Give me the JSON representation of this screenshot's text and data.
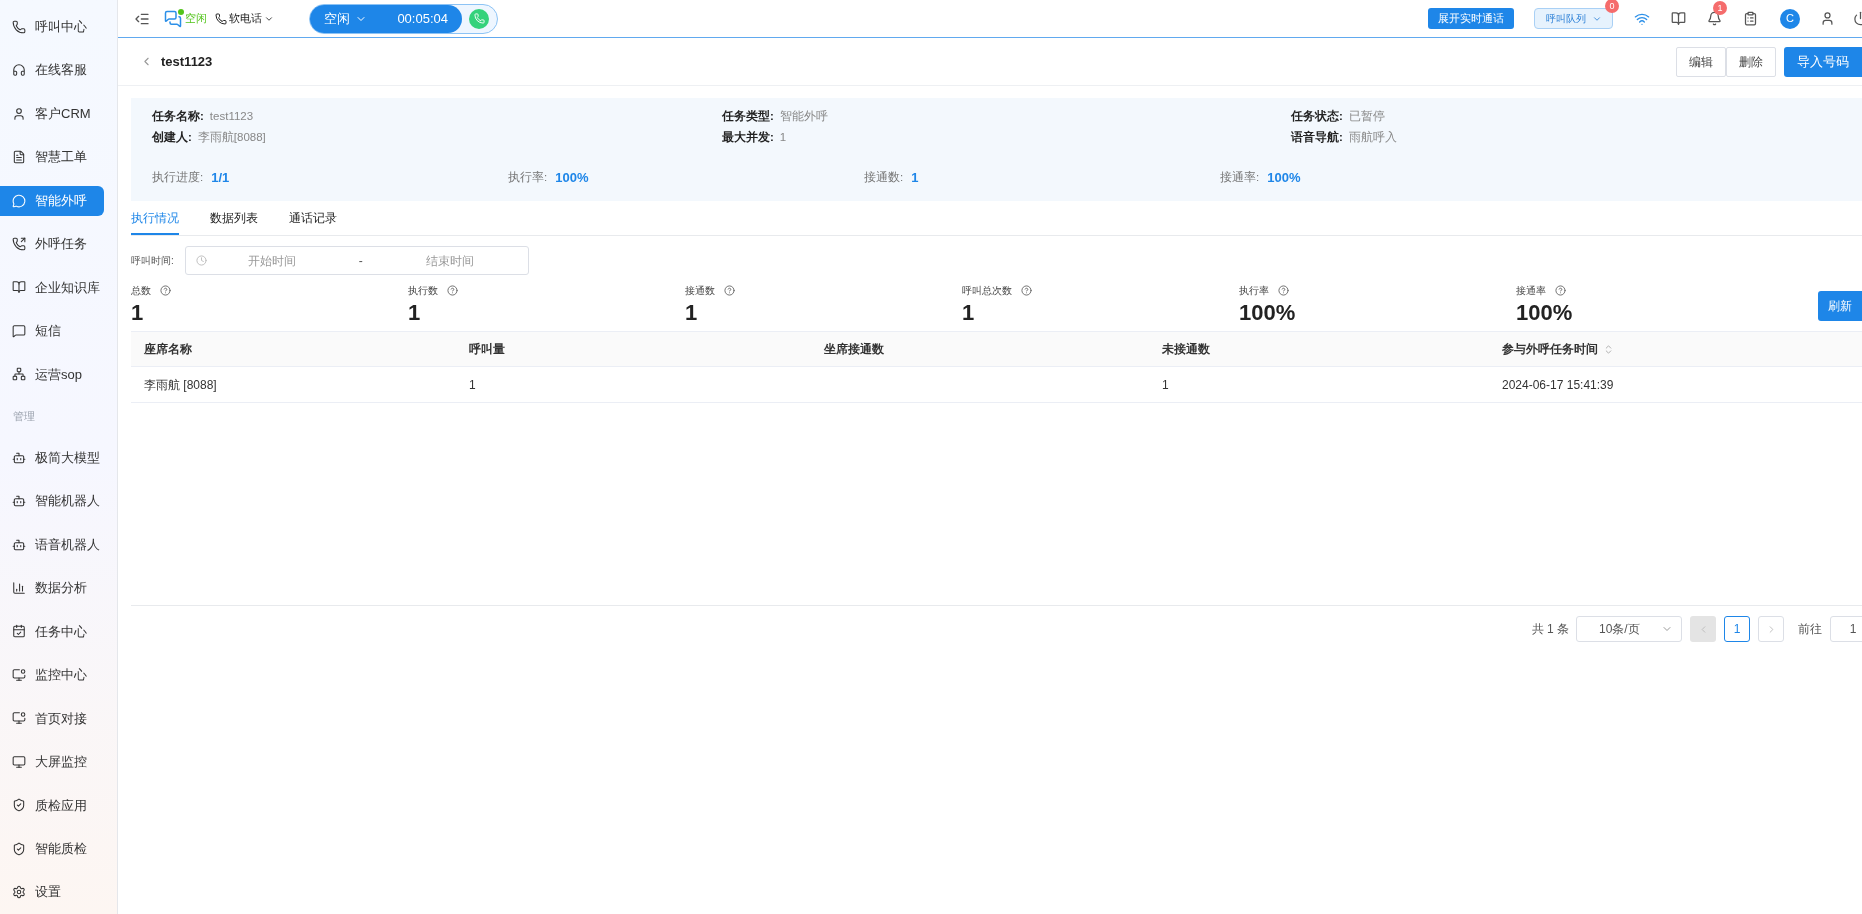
{
  "sidebar": {
    "items": [
      {
        "kind": "item",
        "label": "呼叫中心",
        "selected": false
      },
      {
        "kind": "item",
        "label": "在线客服",
        "selected": false
      },
      {
        "kind": "item",
        "label": "客户CRM",
        "selected": false
      },
      {
        "kind": "item",
        "label": "智慧工单",
        "selected": false
      },
      {
        "kind": "item",
        "label": "智能外呼",
        "selected": true
      },
      {
        "kind": "item",
        "label": "外呼任务",
        "selected": false
      },
      {
        "kind": "item",
        "label": "企业知识库",
        "selected": false
      },
      {
        "kind": "item",
        "label": "短信",
        "selected": false
      },
      {
        "kind": "item",
        "label": "运营sop",
        "selected": false
      },
      {
        "kind": "section",
        "label": "管理"
      },
      {
        "kind": "item",
        "label": "极简大模型",
        "selected": false
      },
      {
        "kind": "item",
        "label": "智能机器人",
        "selected": false
      },
      {
        "kind": "item",
        "label": "语音机器人",
        "selected": false
      },
      {
        "kind": "item",
        "label": "数据分析",
        "selected": false
      },
      {
        "kind": "item",
        "label": "任务中心",
        "selected": false
      },
      {
        "kind": "item",
        "label": "监控中心",
        "selected": false
      },
      {
        "kind": "item",
        "label": "首页对接",
        "selected": false
      },
      {
        "kind": "item",
        "label": "大屏监控",
        "selected": false
      },
      {
        "kind": "item",
        "label": "质检应用",
        "selected": false
      },
      {
        "kind": "item",
        "label": "智能质检",
        "selected": false
      },
      {
        "kind": "item",
        "label": "设置",
        "selected": false
      }
    ]
  },
  "top_bar": {
    "status": "空闲",
    "phone_mode": "软电话",
    "call_state": "空闲",
    "timer": "00:05:04",
    "live_call_button": "展开实时通话",
    "queue": {
      "label": "呼叫队列",
      "badge": "0"
    },
    "notification_badge": "1",
    "avatar": "C"
  },
  "header": {
    "title": "test1123",
    "buttons": [
      {
        "label": "编辑",
        "kind": "default"
      },
      {
        "label": "删除",
        "kind": "default"
      },
      {
        "label": "导入号码",
        "kind": "primary"
      }
    ]
  },
  "info": {
    "fields": [
      {
        "label": "任务名称:",
        "value": "test1123"
      },
      {
        "label": "任务类型:",
        "value": "智能外呼"
      },
      {
        "label": "任务状态:",
        "value": "已暂停"
      },
      {
        "label": "创建人:",
        "value": "李雨航[8088]"
      },
      {
        "label": "最大并发:",
        "value": "1"
      },
      {
        "label": "语音导航:",
        "value": "雨航呼入"
      }
    ],
    "metrics": [
      {
        "label": "执行进度:",
        "value": "1/1"
      },
      {
        "label": "执行率:",
        "value": "100%"
      },
      {
        "label": "接通数:",
        "value": "1"
      },
      {
        "label": "接通率:",
        "value": "100%"
      }
    ]
  },
  "tabs": [
    {
      "label": "执行情况",
      "selected": true
    },
    {
      "label": "数据列表",
      "selected": false
    },
    {
      "label": "通话记录",
      "selected": false
    }
  ],
  "filter": {
    "label": "呼叫时间:",
    "start_placeholder": "开始时间",
    "separator": "-",
    "end_placeholder": "结束时间"
  },
  "stats": [
    {
      "label": "总数",
      "value": "1"
    },
    {
      "label": "执行数",
      "value": "1"
    },
    {
      "label": "接通数",
      "value": "1"
    },
    {
      "label": "呼叫总次数",
      "value": "1"
    },
    {
      "label": "执行率",
      "value": "100%"
    },
    {
      "label": "接通率",
      "value": "100%"
    }
  ],
  "refresh_button": "刷新",
  "table": {
    "columns": [
      {
        "label": "座席名称",
        "sortable": false
      },
      {
        "label": "呼叫量",
        "sortable": false
      },
      {
        "label": "坐席接通数",
        "sortable": false
      },
      {
        "label": "未接通数",
        "sortable": false
      },
      {
        "label": "参与外呼任务时间",
        "sortable": true
      }
    ],
    "rows": [
      [
        "李雨航 [8088]",
        "1",
        "",
        "1",
        "2024-06-17 15:41:39"
      ]
    ]
  },
  "pagination": {
    "total": "共 1 条",
    "page_size": "10条/页",
    "pages": [
      {
        "label": "1",
        "selected": true
      }
    ],
    "goto_label": "前往",
    "goto_value": "1"
  }
}
